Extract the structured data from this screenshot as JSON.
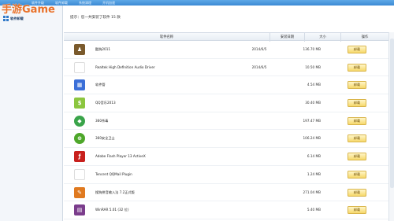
{
  "watermark": "手游Game",
  "topbar": {
    "tabs": [
      "软件升级",
      "软件卸载",
      "系统清理",
      "开机加速"
    ]
  },
  "sidebar": {
    "item_label": "软件卸载"
  },
  "summary": "提示：您一共安装了软件 15 款",
  "table": {
    "headers": [
      "软件名称",
      "安装日期",
      "大小",
      "操作"
    ],
    "rows": [
      {
        "icon": "lock-app-icon",
        "color": "#7a5a2c",
        "glyph": "♟",
        "name": "酷狗2011",
        "date": "2014/6/5",
        "size": "136.70 MB",
        "action": "卸载"
      },
      {
        "icon": "speaker-icon",
        "color": "#ffffff",
        "glyph": "",
        "name": "Realtek High Definition Audio Driver",
        "date": "2014/6/5",
        "size": "10.50 MB",
        "action": "卸载"
      },
      {
        "icon": "grid-app-icon",
        "color": "#3b6fd8",
        "glyph": "▦",
        "name": "软件管",
        "date": "",
        "size": "4.54 MB",
        "action": "卸载"
      },
      {
        "icon": "dollar-icon",
        "color": "#8cc63f",
        "glyph": "$",
        "name": "QQ音乐2013",
        "date": "",
        "size": "30.40 MB",
        "action": "卸载"
      },
      {
        "icon": "shield-icon",
        "color": "#3aa44a",
        "glyph": "◆",
        "name": "360杀毒",
        "date": "",
        "size": "197.47 MB",
        "action": "卸载"
      },
      {
        "icon": "guard-icon",
        "color": "#4ea72a",
        "glyph": "⊕",
        "name": "360安全卫士",
        "date": "",
        "size": "106.24 MB",
        "action": "卸载"
      },
      {
        "icon": "flash-icon",
        "color": "#c8201d",
        "glyph": "ƒ",
        "name": "Adobe Flash Player 13 ActiveX",
        "date": "",
        "size": "6.14 MB",
        "action": "卸载"
      },
      {
        "icon": "tencent-icon",
        "color": "#ffffff",
        "glyph": "",
        "name": "Tencent QQMail Plugin",
        "date": "",
        "size": "1.24 MB",
        "action": "卸载"
      },
      {
        "icon": "input-method-icon",
        "color": "#e07a20",
        "glyph": "✎",
        "name": "搜狗拼音输入法 7.2正式版",
        "date": "",
        "size": "271.04 MB",
        "action": "卸载"
      },
      {
        "icon": "winrar-icon",
        "color": "#7b3d8c",
        "glyph": "▤",
        "name": "WinRAR 5.01 (32 位)",
        "date": "",
        "size": "5.40 MB",
        "action": "卸载"
      }
    ]
  }
}
